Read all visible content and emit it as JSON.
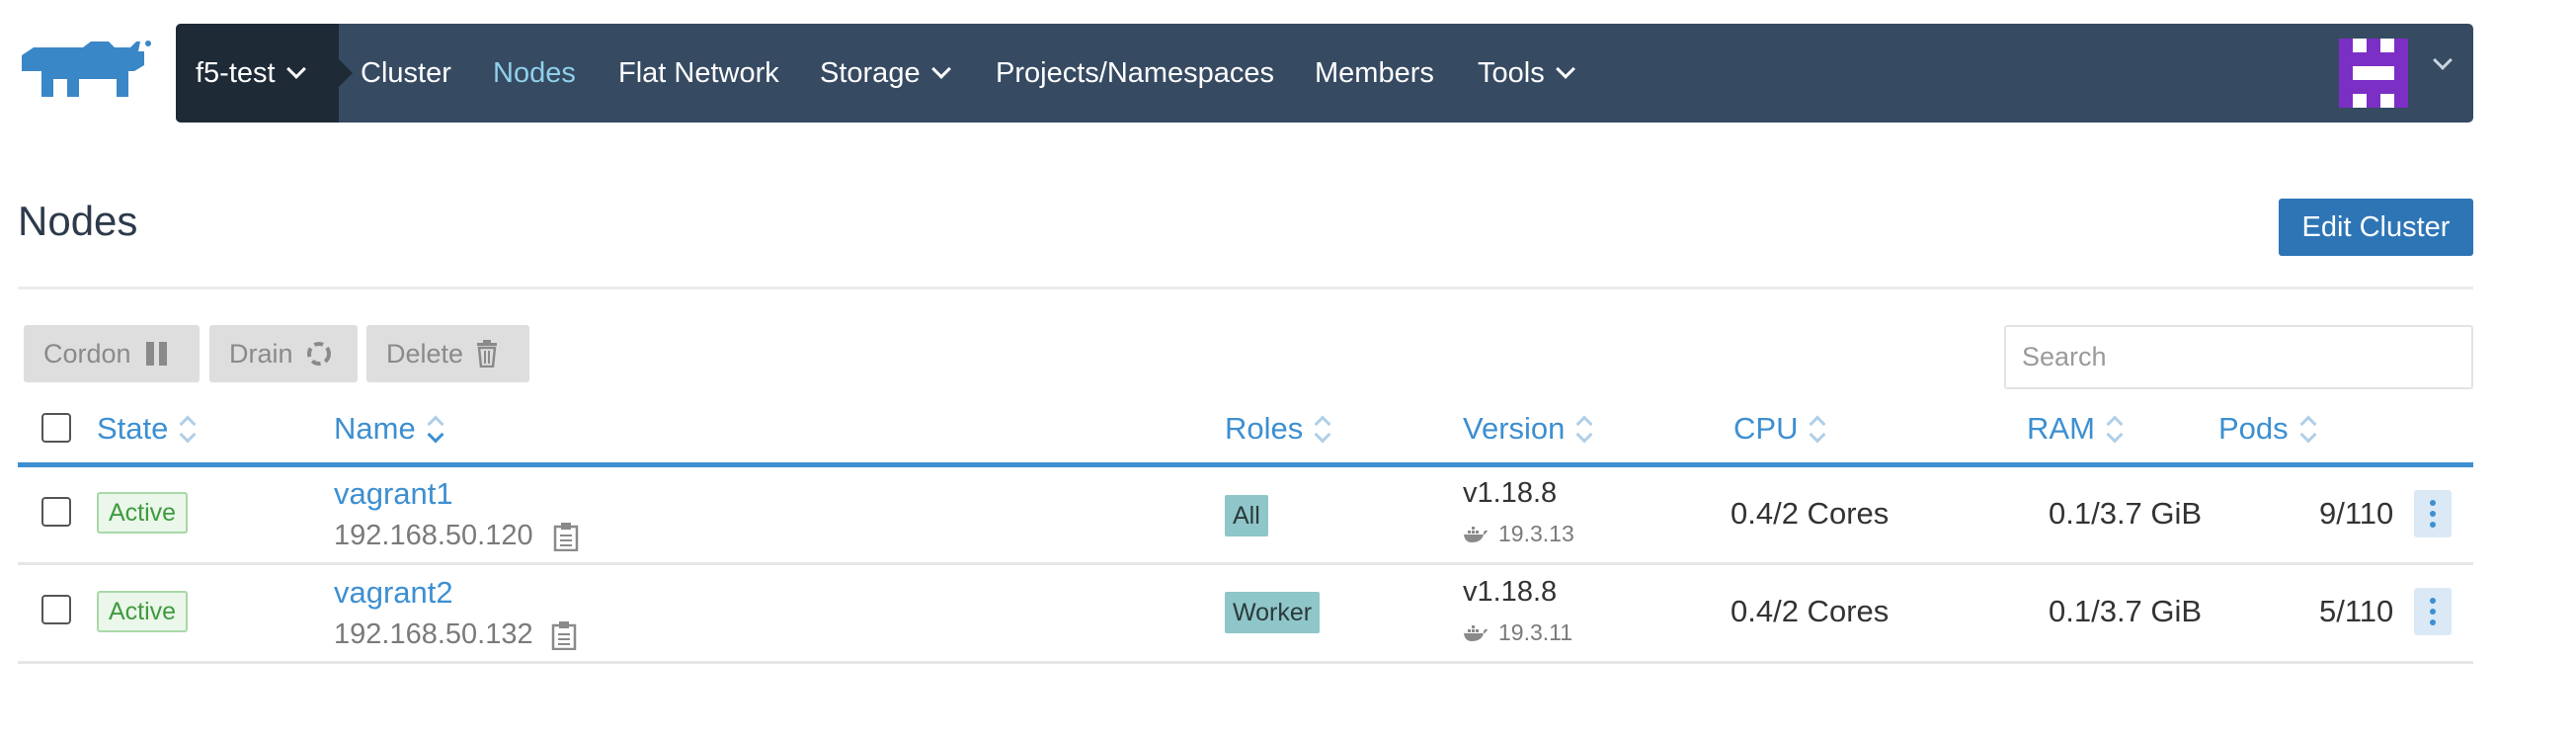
{
  "topbar": {
    "cluster_name": "f5-test",
    "nav": [
      "Cluster",
      "Nodes",
      "Flat Network",
      "Storage",
      "Projects/Namespaces",
      "Members",
      "Tools"
    ],
    "active": "Nodes",
    "bg_color": "#364a62",
    "active_color": "#8fd0ea"
  },
  "header": {
    "title": "Nodes",
    "edit_button": "Edit Cluster"
  },
  "actions": {
    "cordon": "Cordon",
    "drain": "Drain",
    "delete": "Delete"
  },
  "search": {
    "placeholder": "Search"
  },
  "table": {
    "columns": [
      "State",
      "Name",
      "Roles",
      "Version",
      "CPU",
      "RAM",
      "Pods"
    ],
    "rows": [
      {
        "state": "Active",
        "name": "vagrant1",
        "ip": "192.168.50.120",
        "role": "All",
        "version": "v1.18.8",
        "docker_version": "19.3.13",
        "cpu": "0.4/2 Cores",
        "ram": "0.1/3.7 GiB",
        "pods": "9/110"
      },
      {
        "state": "Active",
        "name": "vagrant2",
        "ip": "192.168.50.132",
        "role": "Worker",
        "version": "v1.18.8",
        "docker_version": "19.3.11",
        "cpu": "0.4/2 Cores",
        "ram": "0.1/3.7 GiB",
        "pods": "5/110"
      }
    ]
  },
  "colors": {
    "link": "#3d8fd1",
    "primary_button": "#2e75b6",
    "state_active": "#3f9a3f",
    "role_badge": "#8fc6c9"
  }
}
